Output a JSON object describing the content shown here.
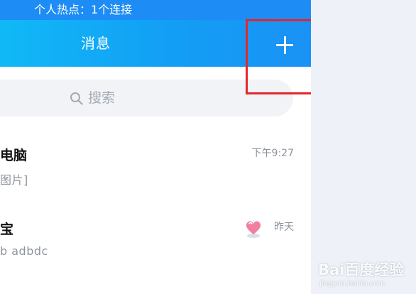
{
  "status_bar": {
    "hotspot_text": "个人热点：1个连接"
  },
  "nav": {
    "title": "消息",
    "add_icon": "plus-icon"
  },
  "search": {
    "placeholder": "搜索",
    "icon": "search-icon"
  },
  "messages": [
    {
      "name": "电脑",
      "preview": "图片]",
      "time": "下午9:27"
    },
    {
      "name": "宝",
      "preview": "b  adbdc",
      "time": "昨天",
      "icon": "heart-icon"
    }
  ],
  "colors": {
    "status_bar": "#1d8cf5",
    "nav_gradient_start": "#10b9f6",
    "nav_gradient_end": "#1a92f5",
    "highlight": "#e5262a",
    "background": "#eef2f8"
  },
  "watermark": {
    "text": "Bai百度经验",
    "sub": "jingyan.baidu.com"
  }
}
